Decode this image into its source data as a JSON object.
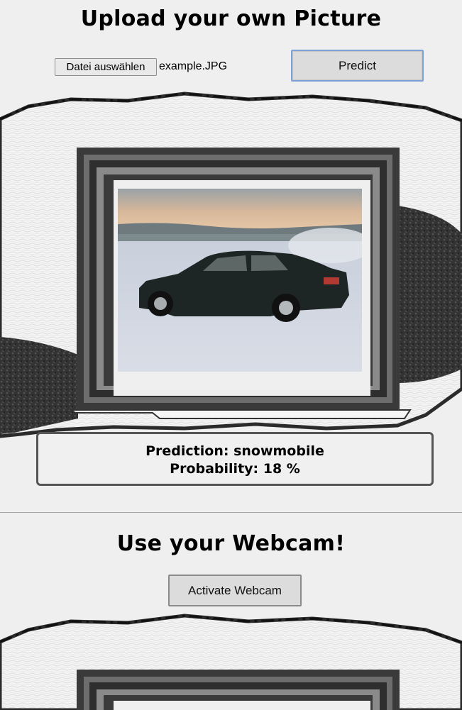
{
  "upload_section": {
    "title": "Upload your own Picture",
    "file_button_label": "Datei auswählen",
    "file_name": "example.JPG",
    "predict_label": "Predict"
  },
  "result": {
    "prediction_text": "Prediction: snowmobile",
    "probability_text": "Probability: 18 %"
  },
  "webcam_section": {
    "title": "Use your Webcam!",
    "activate_label": "Activate Webcam"
  },
  "colors": {
    "background": "#efefef",
    "frame_dark": "#3a3a3a",
    "result_border": "#555555",
    "predict_focus_border": "#7fa1d6"
  },
  "icons": {
    "frame_art": "painted-picture-frame-illustration",
    "photo": "black-car-on-snow-photo"
  }
}
